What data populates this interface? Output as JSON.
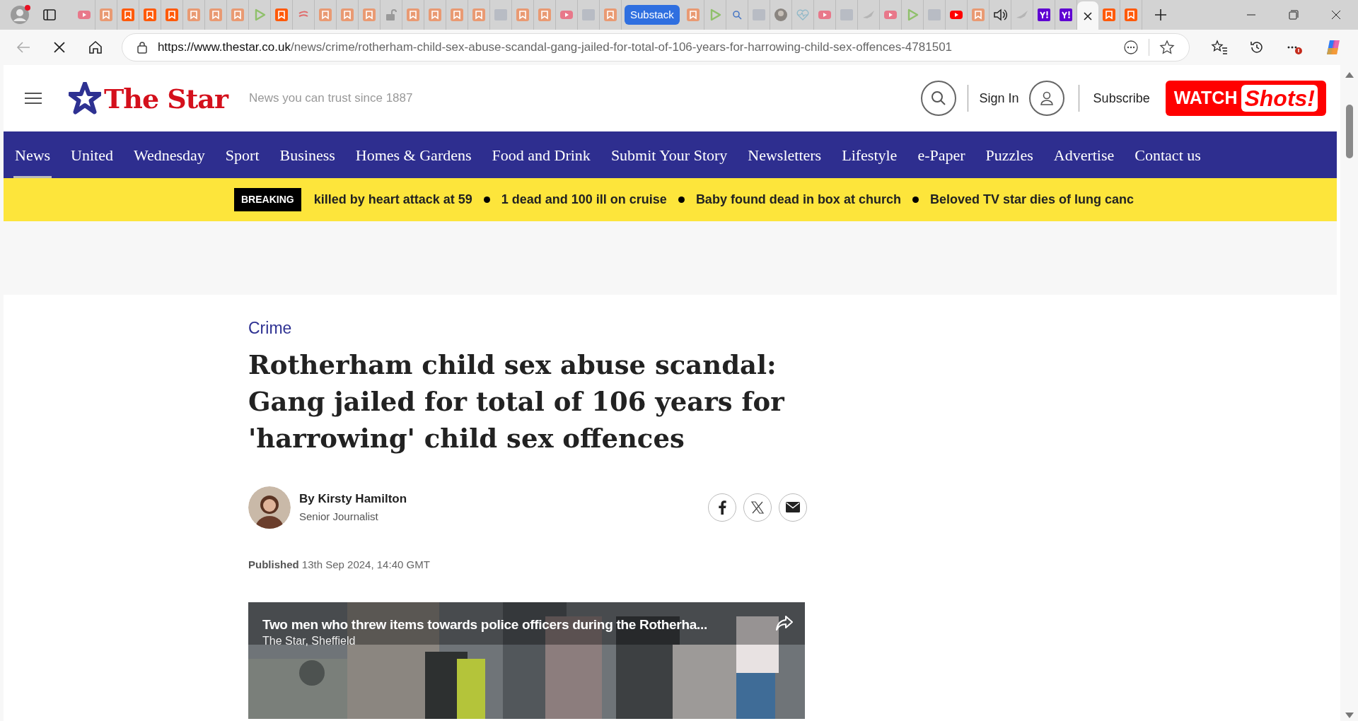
{
  "browser": {
    "tabs": [
      {
        "kind": "youtube",
        "selected": false
      },
      {
        "kind": "bookmark-light",
        "selected": false
      },
      {
        "kind": "bookmark",
        "selected": false
      },
      {
        "kind": "bookmark",
        "selected": false
      },
      {
        "kind": "bookmark",
        "selected": false
      },
      {
        "kind": "bookmark-light",
        "selected": false
      },
      {
        "kind": "bookmark-light",
        "selected": false
      },
      {
        "kind": "bookmark-light",
        "selected": false
      },
      {
        "kind": "play",
        "selected": false
      },
      {
        "kind": "bookmark",
        "selected": false
      },
      {
        "kind": "swirl",
        "selected": false
      },
      {
        "kind": "bookmark-light",
        "selected": false
      },
      {
        "kind": "bookmark-light",
        "selected": false
      },
      {
        "kind": "bookmark-light",
        "selected": false
      },
      {
        "kind": "lock",
        "selected": false
      },
      {
        "kind": "bookmark-light",
        "selected": false
      },
      {
        "kind": "bookmark-light",
        "selected": false
      },
      {
        "kind": "bookmark-light",
        "selected": false
      },
      {
        "kind": "bookmark-light",
        "selected": false
      },
      {
        "kind": "grey-square",
        "selected": false
      },
      {
        "kind": "bookmark-light",
        "selected": false
      },
      {
        "kind": "bookmark-light",
        "selected": false
      },
      {
        "kind": "youtube",
        "selected": false
      },
      {
        "kind": "grey-square",
        "selected": false
      },
      {
        "kind": "bookmark-light",
        "selected": false
      },
      {
        "kind": "group",
        "label": "Substack",
        "selected": false
      },
      {
        "kind": "bookmark-light",
        "selected": false
      },
      {
        "kind": "play",
        "selected": false
      },
      {
        "kind": "search",
        "selected": false
      },
      {
        "kind": "grey-square",
        "selected": false
      },
      {
        "kind": "avatar",
        "selected": false
      },
      {
        "kind": "pulse",
        "selected": false
      },
      {
        "kind": "youtube",
        "selected": false
      },
      {
        "kind": "grey-square",
        "selected": false
      },
      {
        "kind": "bird",
        "selected": false
      },
      {
        "kind": "youtube",
        "selected": false
      },
      {
        "kind": "play",
        "selected": false
      },
      {
        "kind": "grey-square",
        "selected": false
      },
      {
        "kind": "youtube-red",
        "selected": false
      },
      {
        "kind": "bookmark-light",
        "selected": false
      },
      {
        "kind": "speaker",
        "selected": false
      },
      {
        "kind": "bird",
        "selected": false
      },
      {
        "kind": "yahoo",
        "selected": false
      },
      {
        "kind": "yahoo",
        "selected": false
      },
      {
        "kind": "active",
        "selected": true
      },
      {
        "kind": "bookmark",
        "selected": false
      },
      {
        "kind": "bookmark",
        "selected": false
      }
    ],
    "url_host": "https://www.thestar.co.uk",
    "url_path": "/news/crime/rotherham-child-sex-abuse-scandal-gang-jailed-for-total-of-106-years-for-harrowing-child-sex-offences-4781501"
  },
  "header": {
    "logo": "The Star",
    "tagline": "News you can trust since 1887",
    "sign_in": "Sign In",
    "subscribe": "Subscribe",
    "watch": "WATCH",
    "shots": "Shots!"
  },
  "nav": [
    {
      "label": "News",
      "selected": true
    },
    {
      "label": "United",
      "selected": false
    },
    {
      "label": "Wednesday",
      "selected": false
    },
    {
      "label": "Sport",
      "selected": false
    },
    {
      "label": "Business",
      "selected": false
    },
    {
      "label": "Homes & Gardens",
      "selected": false
    },
    {
      "label": "Food and Drink",
      "selected": false
    },
    {
      "label": "Submit Your Story",
      "selected": false
    },
    {
      "label": "Newsletters",
      "selected": false
    },
    {
      "label": "Lifestyle",
      "selected": false
    },
    {
      "label": "e-Paper",
      "selected": false
    },
    {
      "label": "Puzzles",
      "selected": false
    },
    {
      "label": "Advertise",
      "selected": false
    },
    {
      "label": "Contact us",
      "selected": false
    }
  ],
  "breaking": {
    "label": "BREAKING",
    "items": [
      "killed by heart attack at 59",
      "1 dead and 100 ill on cruise",
      "Baby found dead in box at church",
      "Beloved TV star dies of lung canc"
    ]
  },
  "article": {
    "category": "Crime",
    "headline": "Rotherham child sex abuse scandal: Gang jailed for total of 106 years for 'harrowing' child sex offences",
    "author": "By Kirsty Hamilton",
    "role": "Senior Journalist",
    "published_label": "Published",
    "published": "13th Sep 2024, 14:40 GMT",
    "video": {
      "kind": "picture",
      "title": "Two men who threw items towards police officers during the Rotherha...",
      "source": "The Star, Sheffield"
    }
  }
}
